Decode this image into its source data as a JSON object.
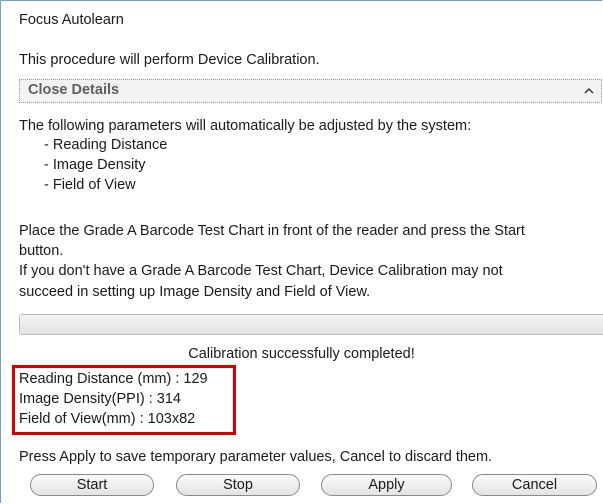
{
  "window": {
    "title": "Focus Autolearn"
  },
  "intro_text": "This procedure will perform Device Calibration.",
  "details": {
    "toggle_label": "Close Details",
    "toggle_icon": "chevron-up-icon",
    "params_intro": "The following parameters will automatically be adjusted by the system:",
    "params": [
      "- Reading Distance",
      "- Image Density",
      "- Field of View"
    ]
  },
  "instructions": {
    "place_line1": "Place the Grade A Barcode Test Chart in front of the reader and press the Start",
    "place_line2": "button.",
    "nochart_line1": "If you don't have a Grade A Barcode Test Chart, Device Calibration may not",
    "nochart_line2": "succeed in setting up Image Density and Field of View."
  },
  "progress": {
    "value_percent": 100
  },
  "status_text": "Calibration successfully completed!",
  "results": {
    "reading_distance": "Reading Distance (mm) : 129",
    "image_density": "Image Density(PPI) : 314",
    "field_of_view": "Field of View(mm) : 103x82",
    "highlight_color": "#d60000"
  },
  "apply_hint": "Press Apply to save temporary parameter values, Cancel to discard them.",
  "buttons": {
    "start": "Start",
    "stop": "Stop",
    "apply": "Apply",
    "cancel": "Cancel"
  }
}
